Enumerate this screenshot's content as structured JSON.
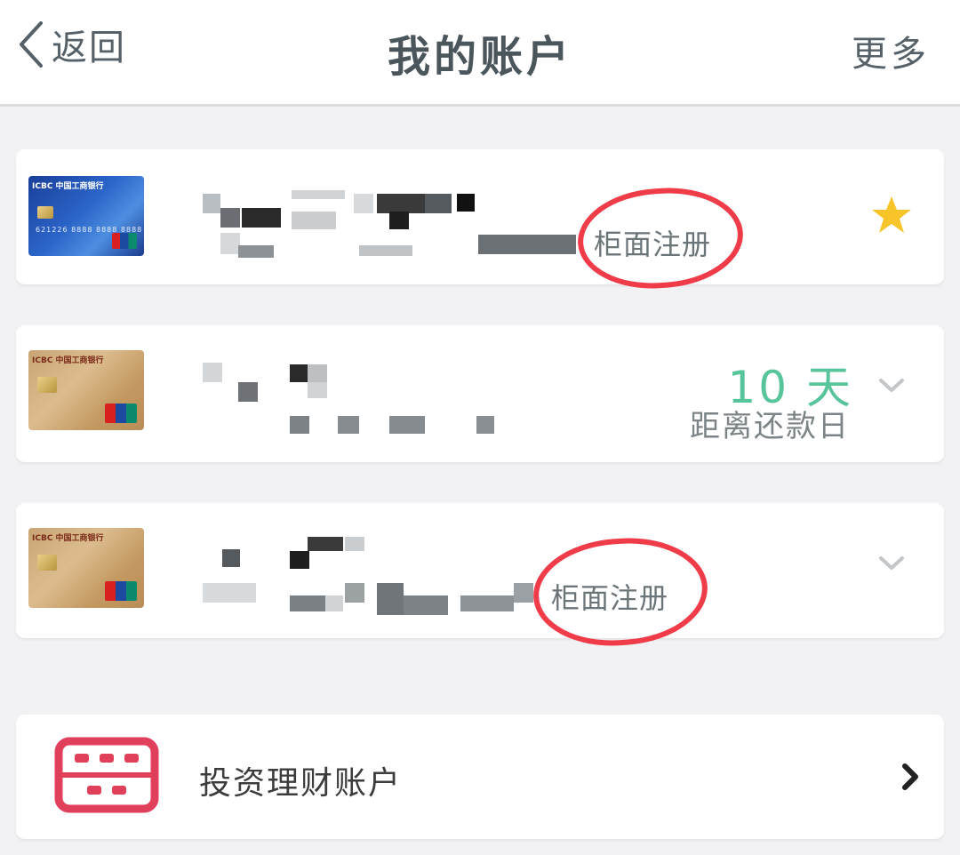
{
  "nav": {
    "back_label": "返回",
    "title": "我的账户",
    "more_label": "更多"
  },
  "accounts": [
    {
      "bank_brand": "ICBC 中国工商银行",
      "card_number": "621226 8888 8888 8888",
      "status": "柜面注册",
      "favorite": true
    },
    {
      "bank_brand": "ICBC 中国工商银行",
      "repay_days": "10 天",
      "repay_label": "距离还款日"
    },
    {
      "bank_brand": "ICBC 中国工商银行",
      "status": "柜面注册"
    }
  ],
  "invest": {
    "label": "投资理财账户"
  },
  "colors": {
    "accent_green": "#58c49a",
    "annotation_red": "#ef3c48",
    "star_gold": "#f7c52a",
    "invest_red": "#e0405a"
  }
}
